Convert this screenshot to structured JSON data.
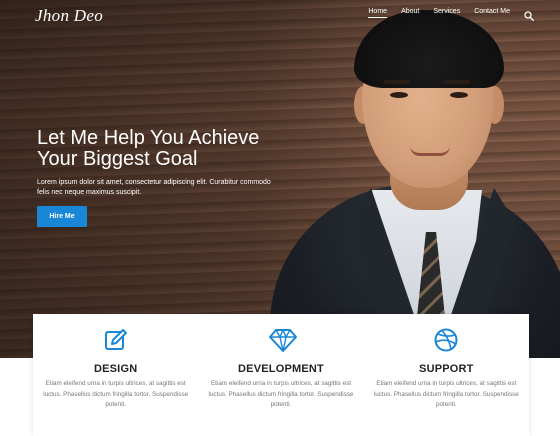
{
  "brand": {
    "name": "Jhon Deo"
  },
  "nav": {
    "items": [
      {
        "label": "Home",
        "active": true
      },
      {
        "label": "About",
        "active": false
      },
      {
        "label": "Services",
        "active": false
      },
      {
        "label": "Contact Me",
        "active": false
      }
    ],
    "search_icon": "search-icon"
  },
  "hero": {
    "title_line1": "Let Me Help You Achieve",
    "title_line2": "Your Biggest Goal",
    "subtitle": "Lorem ipsum dolor sit amet, consectetur adipiscing elit. Curabitur commodo felis nec neque maximus suscipit.",
    "cta_label": "Hire Me"
  },
  "services": [
    {
      "icon": "edit-icon",
      "title": "DESIGN",
      "description": "Etiam eleifend urna in turpis ultrices, at sagittis est luctus. Phasellus dictum fringilla tortor. Suspendisse potenti."
    },
    {
      "icon": "diamond-icon",
      "title": "DEVELOPMENT",
      "description": "Etiam eleifend urna in turpis ultrices, at sagittis est luctus. Phasellus dictum fringilla tortor. Suspendisse potenti."
    },
    {
      "icon": "dribbble-icon",
      "title": "SUPPORT",
      "description": "Etiam eleifend urna in turpis ultrices, at sagittis est luctus. Phasellus dictum fringilla tortor. Suspendisse potenti."
    }
  ],
  "colors": {
    "accent": "#1a86d6",
    "icon_blue": "#1a86d6"
  }
}
